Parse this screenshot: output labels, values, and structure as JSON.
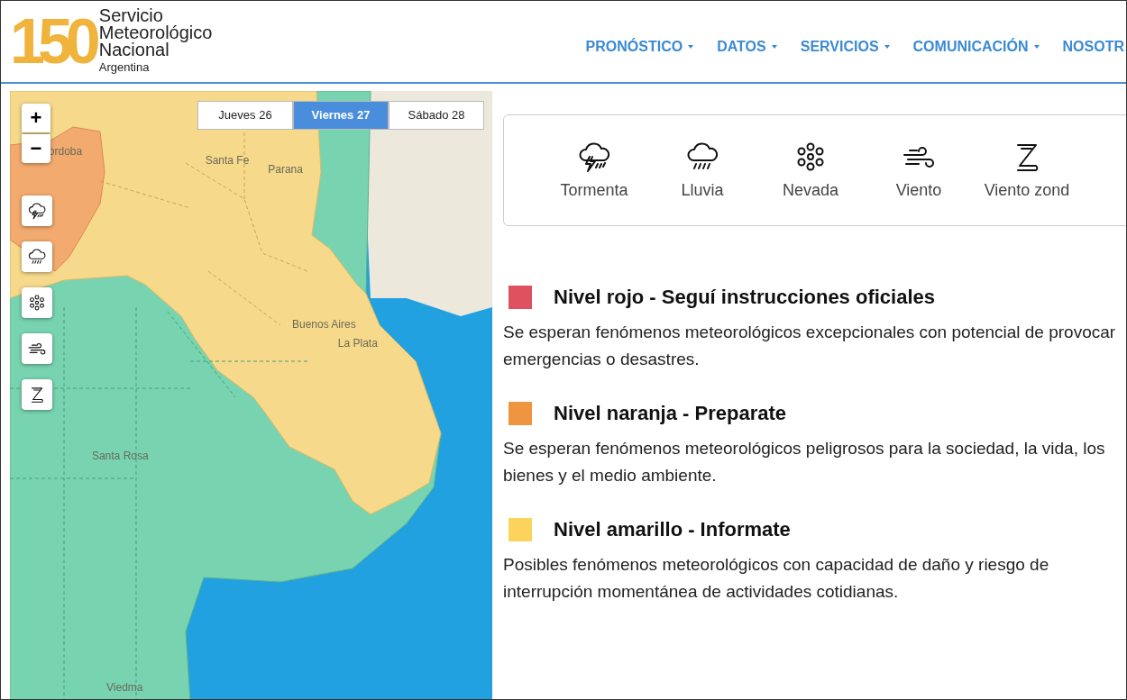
{
  "header": {
    "logo_number": "150",
    "org_name": [
      "Servicio",
      "Meteorológico",
      "Nacional"
    ],
    "country": "Argentina"
  },
  "nav": [
    {
      "label": "PRONÓSTICO",
      "dropdown": true
    },
    {
      "label": "DATOS",
      "dropdown": true
    },
    {
      "label": "SERVICIOS",
      "dropdown": true
    },
    {
      "label": "COMUNICACIÓN",
      "dropdown": true
    },
    {
      "label": "NOSOTR",
      "dropdown": false
    }
  ],
  "map": {
    "zoom": [
      "+",
      "−"
    ],
    "days": [
      {
        "label": "Jueves 26",
        "selected": false
      },
      {
        "label": "Viernes 27",
        "selected": true
      },
      {
        "label": "Sábado 28",
        "selected": false
      }
    ],
    "layers": [
      {
        "kind": "storm"
      },
      {
        "kind": "rain"
      },
      {
        "kind": "snow"
      },
      {
        "kind": "wind"
      },
      {
        "kind": "zonda"
      }
    ],
    "cities": [
      "ordoba",
      "Santa Fe",
      "Parana",
      "Buenos Aires",
      "La Plata",
      "Santa Rosa",
      "Viedma"
    ]
  },
  "phenomena": [
    {
      "kind": "storm",
      "label": "Tormenta"
    },
    {
      "kind": "rain",
      "label": "Lluvia"
    },
    {
      "kind": "snow",
      "label": "Nevada"
    },
    {
      "kind": "wind",
      "label": "Viento"
    },
    {
      "kind": "zonda",
      "label": "Viento zond"
    }
  ],
  "levels": [
    {
      "title": "Nivel rojo - Seguí instrucciones oficiales",
      "color": "#e0515f",
      "description": "Se esperan fenómenos meteorológicos excepcionales con potencial de provocar emergencias o desastres."
    },
    {
      "title": "Nivel naranja - Preparate",
      "color": "#f0953f",
      "description": "Se esperan fenómenos meteorológicos peligrosos para la sociedad, la vida, los bienes y el medio ambiente."
    },
    {
      "title": "Nivel amarillo - Informate",
      "color": "#fcd35b",
      "description": "Posibles fenómenos meteorológicos con capacidad de daño y riesgo de interrupción momentánea de actividades cotidianas."
    }
  ]
}
